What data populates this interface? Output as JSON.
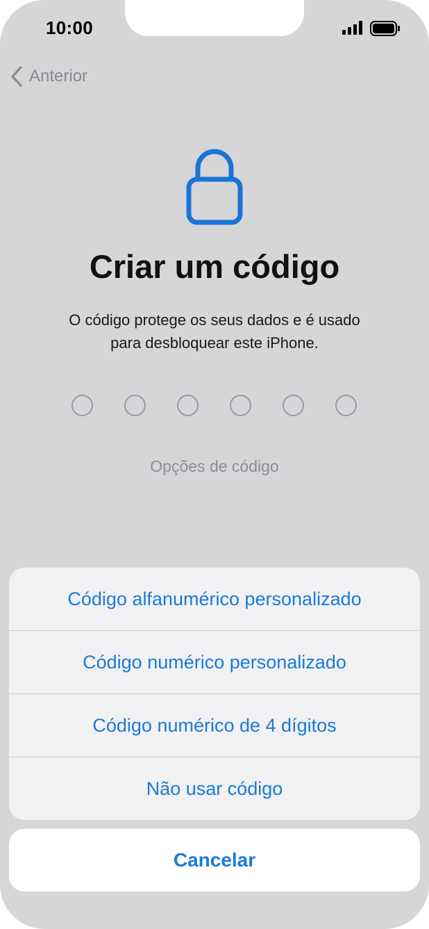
{
  "status_bar": {
    "time": "10:00",
    "signal_icon": "cellular-signal-icon",
    "battery_icon": "battery-icon"
  },
  "nav": {
    "back_label": "Anterior",
    "back_icon": "chevron-left-icon"
  },
  "header": {
    "icon": "lock-icon",
    "title": "Criar um código",
    "description_line1": "O código protege os seus dados e é usado",
    "description_line2": "para desbloquear este iPhone."
  },
  "passcode": {
    "digit_count": 6,
    "filled": 0
  },
  "options_link": "Opções de código",
  "action_sheet": {
    "items": [
      {
        "label": "Código alfanumérico personalizado"
      },
      {
        "label": "Código numérico personalizado"
      },
      {
        "label": "Código numérico de 4 dígitos"
      },
      {
        "label": "Não usar código"
      }
    ],
    "cancel_label": "Cancelar"
  },
  "colors": {
    "accent": "#1a7ad8",
    "background": "#d6d5d8",
    "sheet": "#f2f2f4"
  }
}
